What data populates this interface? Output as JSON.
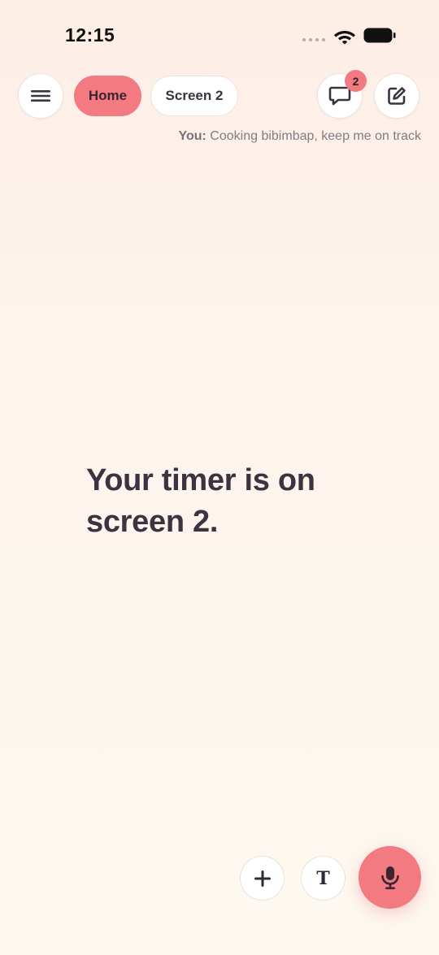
{
  "status_bar": {
    "time": "12:15",
    "icons": [
      "signal-dots-icon",
      "wifi-icon",
      "battery-icon"
    ]
  },
  "nav": {
    "menu_icon": "hamburger-menu-icon",
    "tabs": [
      {
        "label": "Home",
        "active": true
      },
      {
        "label": "Screen 2",
        "active": false
      }
    ],
    "chat_icon": "chat-bubble-icon",
    "chat_badge_count": "2",
    "edit_icon": "compose-icon"
  },
  "context": {
    "speaker": "You:",
    "message": " Cooking bibimbap, keep me on track"
  },
  "main": {
    "message": "Your timer is on screen 2."
  },
  "actions": {
    "add_icon": "plus-icon",
    "text_label": "T",
    "mic_icon": "microphone-icon"
  },
  "colors": {
    "accent": "#f47a82",
    "text": "#3a3340",
    "muted": "#847a83",
    "background_top": "#fdeee6",
    "background_bottom": "#fdf8f0"
  }
}
